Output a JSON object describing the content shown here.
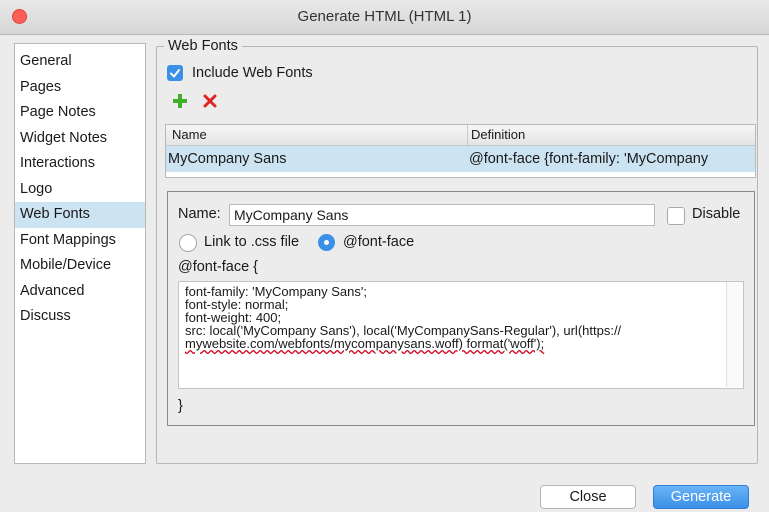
{
  "window": {
    "title": "Generate HTML (HTML 1)"
  },
  "sidebar": {
    "items": [
      {
        "label": "General"
      },
      {
        "label": "Pages"
      },
      {
        "label": "Page Notes"
      },
      {
        "label": "Widget Notes"
      },
      {
        "label": "Interactions"
      },
      {
        "label": "Logo"
      },
      {
        "label": "Web Fonts",
        "selected": true
      },
      {
        "label": "Font Mappings"
      },
      {
        "label": "Mobile/Device"
      },
      {
        "label": "Advanced"
      },
      {
        "label": "Discuss"
      }
    ]
  },
  "web_fonts": {
    "group_title": "Web Fonts",
    "include_label": "Include Web Fonts",
    "include_checked": true,
    "add_icon": "plus-icon",
    "delete_icon": "x-icon",
    "table": {
      "columns": [
        "Name",
        "Definition"
      ],
      "rows": [
        {
          "name": "MyCompany Sans",
          "definition": "@font-face {font-family: 'MyCompany"
        }
      ]
    },
    "detail": {
      "name_label": "Name:",
      "name_value": "MyCompany Sans",
      "disable_label": "Disable",
      "radio_link_label": "Link to .css file",
      "radio_fontface_label": "@font-face",
      "selected_option": "@font-face",
      "open_brace": "@font-face {",
      "code_lines": [
        "font-family: 'MyCompany Sans';",
        "font-style: normal;",
        "font-weight: 400;",
        "src: local('MyCompany Sans'), local('MyCompanySans-Regular'), url(https://",
        "mywebsite.com/webfonts/mycompanysans.woff) format('woff');"
      ],
      "close_brace": "}"
    }
  },
  "footer": {
    "close_label": "Close",
    "generate_label": "Generate"
  },
  "colors": {
    "accent": "#3a8fe6",
    "selection": "#cce3f2",
    "add_green": "#3fae29",
    "delete_red": "#e02424"
  }
}
